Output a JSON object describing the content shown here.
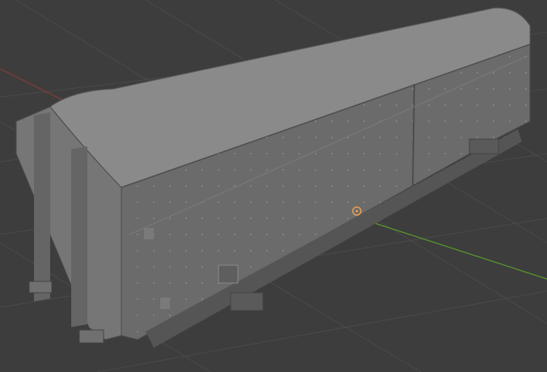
{
  "viewport": {
    "mode": "3d-viewport",
    "shading": "solid",
    "background_color": "#3d3d3d",
    "grid_line_color": "#4a4a4a",
    "x_axis_color": "#8a3a3a",
    "y_axis_color": "#6e9a2a"
  },
  "model": {
    "object": "freight-wagon",
    "description_colors": {
      "roof": "#8c8c8c",
      "side_panel": "#6b6b6b",
      "end_wall": "#7a7a7a",
      "undercarriage": "#5a5a5a"
    }
  },
  "icons": {
    "origin": "object-origin-icon"
  }
}
